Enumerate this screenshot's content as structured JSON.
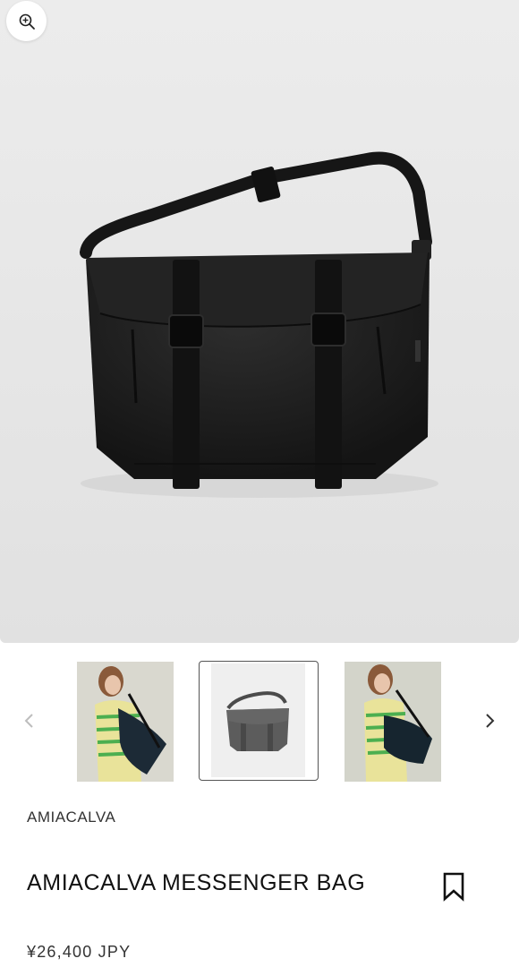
{
  "gallery": {
    "zoom_icon": "zoom-in-icon",
    "main_image": "black-messenger-bag",
    "prev_icon": "chevron-left-icon",
    "next_icon": "chevron-right-icon",
    "thumbnails": [
      {
        "image": "model-wearing-navy-bag",
        "selected": false
      },
      {
        "image": "grey-messenger-bag",
        "selected": true
      },
      {
        "image": "model-wearing-navy-bag-side",
        "selected": false
      }
    ]
  },
  "product": {
    "brand": "AMIACALVA",
    "title": "AMIACALVA MESSENGER BAG",
    "price": "¥26,400 JPY",
    "bookmark_icon": "bookmark-icon"
  },
  "colors": {
    "hero_bg": "#e6e6e6",
    "bag": "#1c1c1c",
    "text": "#111111"
  }
}
